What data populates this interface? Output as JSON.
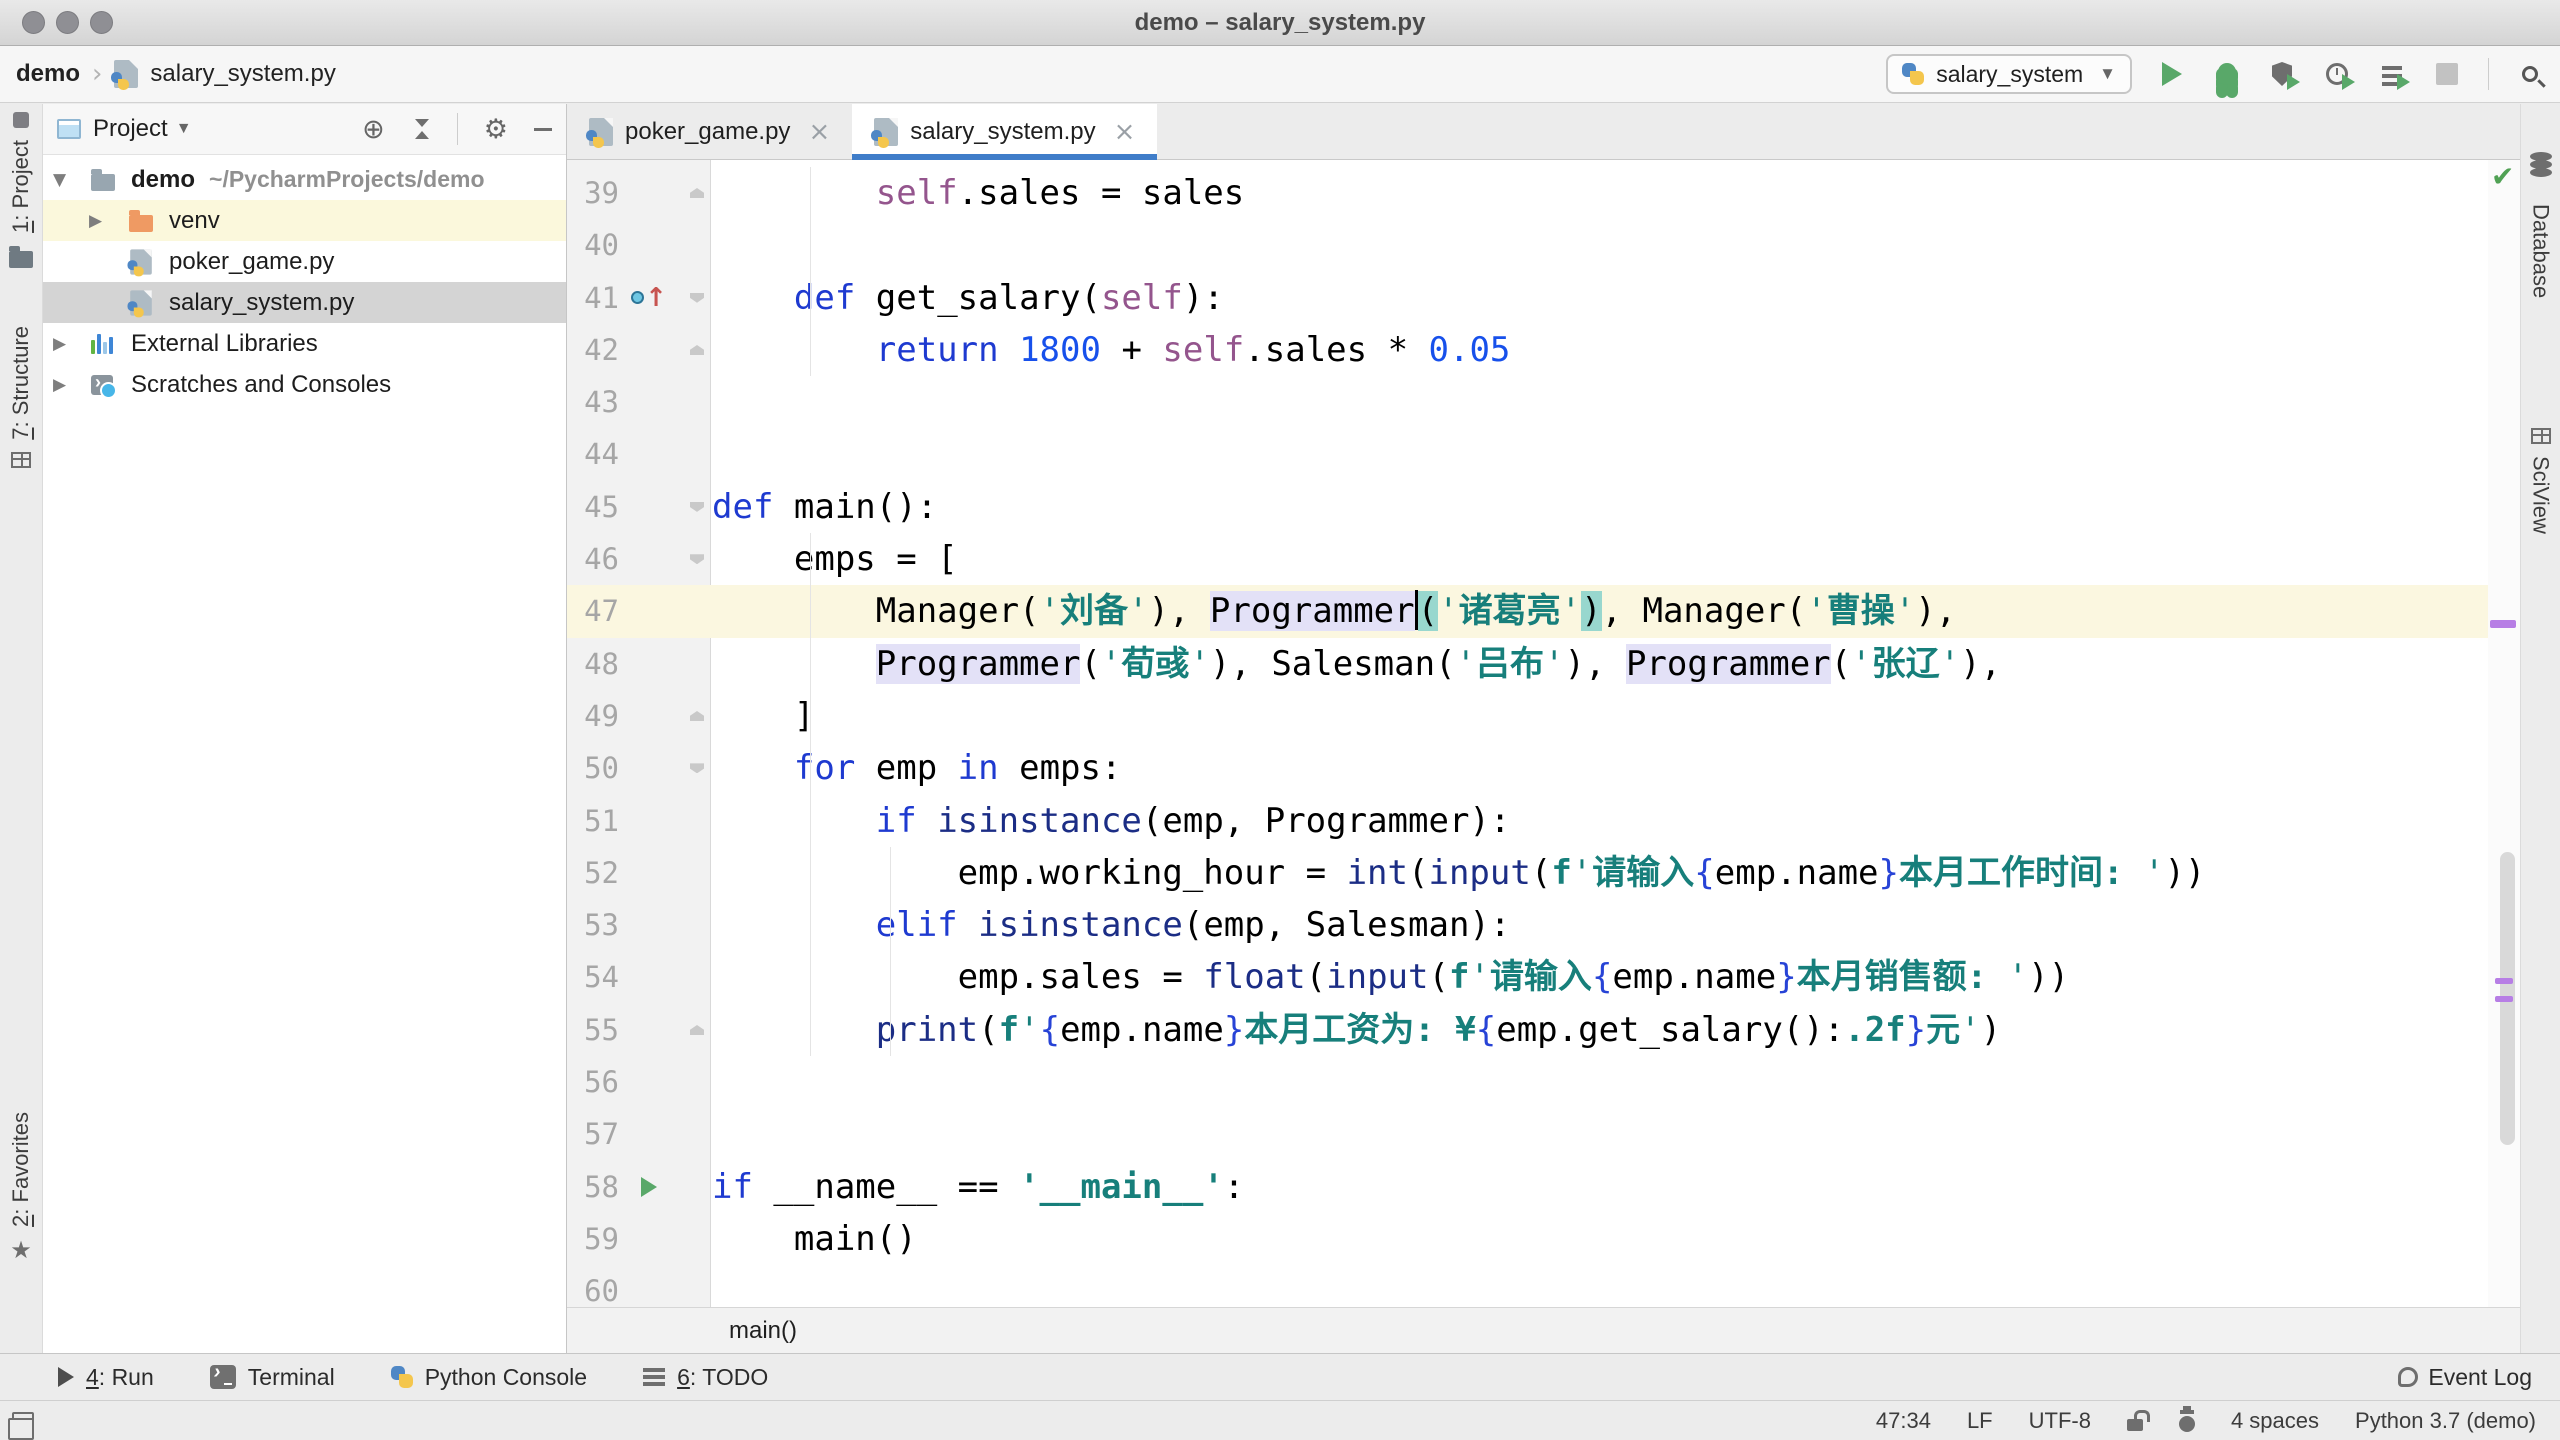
{
  "window": {
    "title": "demo – salary_system.py"
  },
  "topbar": {
    "project_crumb": "demo",
    "file_crumb": "salary_system.py",
    "run_config": "salary_system",
    "actions": [
      "run-icon",
      "debug-icon",
      "run-with-coverage-icon",
      "profiler-icon",
      "concurrency-diagram-icon",
      "stop-icon",
      "search-everywhere-icon"
    ]
  },
  "project_panel": {
    "header": "Project",
    "header_tools": [
      "locate-icon",
      "collapse-all-icon",
      "settings-gear-icon",
      "hide-panel-icon"
    ],
    "tree": [
      {
        "label": "demo",
        "path": "~/PycharmProjects/demo",
        "icon": "folder-gray",
        "chevron": "down",
        "bold": true,
        "level": 0
      },
      {
        "label": "venv",
        "icon": "folder-orange",
        "chevron": "right",
        "level": 1,
        "row": "warm"
      },
      {
        "label": "poker_game.py",
        "icon": "python-file",
        "level": 1
      },
      {
        "label": "salary_system.py",
        "icon": "python-file",
        "level": 1,
        "row": "sel"
      },
      {
        "label": "External Libraries",
        "icon": "libraries",
        "chevron": "right",
        "level": 0
      },
      {
        "label": "Scratches and Consoles",
        "icon": "scratches",
        "chevron": "right",
        "level": 0
      }
    ]
  },
  "tabs": [
    {
      "label": "poker_game.py",
      "active": false
    },
    {
      "label": "salary_system.py",
      "active": true
    }
  ],
  "editor": {
    "current_line": 47,
    "lines": [
      {
        "n": 39,
        "fold": "up",
        "tokens": [
          [
            "p",
            "        "
          ],
          [
            "sf",
            "self"
          ],
          [
            "p",
            ".sales = sales"
          ]
        ]
      },
      {
        "n": 40,
        "tokens": []
      },
      {
        "n": 41,
        "icon": "override",
        "fold": "down",
        "tokens": [
          [
            "p",
            "    "
          ],
          [
            "k",
            "def"
          ],
          [
            "p",
            " get_salary("
          ],
          [
            "sf",
            "self"
          ],
          [
            "p",
            "):"
          ]
        ]
      },
      {
        "n": 42,
        "fold": "up",
        "tokens": [
          [
            "p",
            "        "
          ],
          [
            "k",
            "return"
          ],
          [
            "p",
            " "
          ],
          [
            "n",
            "1800"
          ],
          [
            "p",
            " + "
          ],
          [
            "sf",
            "self"
          ],
          [
            "p",
            ".sales * "
          ],
          [
            "n",
            "0.05"
          ]
        ]
      },
      {
        "n": 43,
        "tokens": []
      },
      {
        "n": 44,
        "tokens": []
      },
      {
        "n": 45,
        "fold": "down",
        "tokens": [
          [
            "k",
            "def"
          ],
          [
            "p",
            " main():"
          ]
        ]
      },
      {
        "n": 46,
        "fold": "down",
        "tokens": [
          [
            "p",
            "    emps = ["
          ]
        ]
      },
      {
        "n": 47,
        "tokens": [
          [
            "p",
            "        Manager("
          ],
          [
            "s",
            "'"
          ],
          [
            "c",
            "刘备"
          ],
          [
            "s",
            "'"
          ],
          [
            "p",
            "), "
          ],
          [
            "hi",
            "Programmer"
          ],
          [
            "cr",
            ""
          ],
          [
            "mb",
            "("
          ],
          [
            "s",
            "'"
          ],
          [
            "c",
            "诸葛亮"
          ],
          [
            "s",
            "'"
          ],
          [
            "mb",
            ")"
          ],
          [
            "p",
            ", Manager("
          ],
          [
            "s",
            "'"
          ],
          [
            "c",
            "曹操"
          ],
          [
            "s",
            "'"
          ],
          [
            "p",
            "),"
          ]
        ]
      },
      {
        "n": 48,
        "tokens": [
          [
            "p",
            "        "
          ],
          [
            "hi",
            "Programmer"
          ],
          [
            "p",
            "("
          ],
          [
            "s",
            "'"
          ],
          [
            "c",
            "荀彧"
          ],
          [
            "s",
            "'"
          ],
          [
            "p",
            "), Salesman("
          ],
          [
            "s",
            "'"
          ],
          [
            "c",
            "吕布"
          ],
          [
            "s",
            "'"
          ],
          [
            "p",
            "), "
          ],
          [
            "hi",
            "Programmer"
          ],
          [
            "p",
            "("
          ],
          [
            "s",
            "'"
          ],
          [
            "c",
            "张辽"
          ],
          [
            "s",
            "'"
          ],
          [
            "p",
            "),"
          ]
        ]
      },
      {
        "n": 49,
        "fold": "up",
        "tokens": [
          [
            "p",
            "    ]"
          ]
        ]
      },
      {
        "n": 50,
        "fold": "down",
        "tokens": [
          [
            "p",
            "    "
          ],
          [
            "k",
            "for"
          ],
          [
            "p",
            " emp "
          ],
          [
            "k",
            "in"
          ],
          [
            "p",
            " emps:"
          ]
        ]
      },
      {
        "n": 51,
        "tokens": [
          [
            "p",
            "        "
          ],
          [
            "k",
            "if"
          ],
          [
            "p",
            " "
          ],
          [
            "b",
            "isinstance"
          ],
          [
            "p",
            "(emp, Programmer):"
          ]
        ]
      },
      {
        "n": 52,
        "tokens": [
          [
            "p",
            "            emp.working_hour = "
          ],
          [
            "b",
            "int"
          ],
          [
            "p",
            "("
          ],
          [
            "b",
            "input"
          ],
          [
            "p",
            "("
          ],
          [
            "sb",
            "f"
          ],
          [
            "s",
            "'"
          ],
          [
            "c",
            "请输入"
          ],
          [
            "br",
            "{"
          ],
          [
            "p",
            "emp.name"
          ],
          [
            "br",
            "}"
          ],
          [
            "c",
            "本月工作时间: "
          ],
          [
            "s",
            "'"
          ],
          [
            "p",
            "))"
          ]
        ]
      },
      {
        "n": 53,
        "tokens": [
          [
            "p",
            "        "
          ],
          [
            "k",
            "elif"
          ],
          [
            "p",
            " "
          ],
          [
            "b",
            "isinstance"
          ],
          [
            "p",
            "(emp, Salesman):"
          ]
        ]
      },
      {
        "n": 54,
        "tokens": [
          [
            "p",
            "            emp.sales = "
          ],
          [
            "b",
            "float"
          ],
          [
            "p",
            "("
          ],
          [
            "b",
            "input"
          ],
          [
            "p",
            "("
          ],
          [
            "sb",
            "f"
          ],
          [
            "s",
            "'"
          ],
          [
            "c",
            "请输入"
          ],
          [
            "br",
            "{"
          ],
          [
            "p",
            "emp.name"
          ],
          [
            "br",
            "}"
          ],
          [
            "c",
            "本月销售额: "
          ],
          [
            "s",
            "'"
          ],
          [
            "p",
            "))"
          ]
        ]
      },
      {
        "n": 55,
        "fold": "up",
        "tokens": [
          [
            "p",
            "        "
          ],
          [
            "b",
            "print"
          ],
          [
            "p",
            "("
          ],
          [
            "sb",
            "f"
          ],
          [
            "s",
            "'"
          ],
          [
            "br",
            "{"
          ],
          [
            "p",
            "emp.name"
          ],
          [
            "br",
            "}"
          ],
          [
            "c",
            "本月工资为: ¥"
          ],
          [
            "br",
            "{"
          ],
          [
            "p",
            "emp.get_salary()"
          ],
          [
            "p",
            ":"
          ],
          [
            "sb",
            ".2f"
          ],
          [
            "br",
            "}"
          ],
          [
            "c",
            "元"
          ],
          [
            "s",
            "'"
          ],
          [
            "p",
            ")"
          ]
        ]
      },
      {
        "n": 56,
        "tokens": []
      },
      {
        "n": 57,
        "tokens": []
      },
      {
        "n": 58,
        "icon": "run",
        "tokens": [
          [
            "k",
            "if"
          ],
          [
            "p",
            " __name__ == "
          ],
          [
            "sb",
            "'__main__'"
          ],
          [
            "p",
            ":"
          ]
        ]
      },
      {
        "n": 59,
        "tokens": [
          [
            "p",
            "    main()"
          ]
        ]
      },
      {
        "n": 60,
        "tokens": []
      }
    ]
  },
  "breadcrumb_bottom": "main()",
  "toolwindow_bar": {
    "left": [
      {
        "icon": "run-tool-icon",
        "label": "4: Run",
        "mn": "4"
      },
      {
        "icon": "terminal-icon",
        "label": "Terminal"
      },
      {
        "icon": "python-console-icon",
        "label": "Python Console"
      },
      {
        "icon": "todo-icon",
        "label": "6: TODO",
        "mn": "6"
      }
    ],
    "event_log": "Event Log"
  },
  "statusbar": {
    "items": [
      {
        "t": "47:34"
      },
      {
        "t": "LF"
      },
      {
        "t": "UTF-8"
      },
      {
        "i": "unlock-icon"
      },
      {
        "i": "hector-icon"
      },
      {
        "t": "4 spaces"
      },
      {
        "t": "Python 3.7 (demo)"
      }
    ]
  },
  "left_stripe": [
    {
      "label": "1: Project",
      "mn": "1",
      "icon": "folder-icon",
      "active": true
    },
    {
      "label": "7: Structure",
      "mn": "7",
      "icon": "structure-icon"
    },
    {
      "label": "2: Favorites",
      "mn": "2",
      "icon": "star-icon",
      "bottom": true
    }
  ],
  "right_stripe": [
    {
      "label": "Database",
      "icon": "database-icon"
    },
    {
      "label": "SciView",
      "icon": "sciview-icon"
    }
  ],
  "colors": {
    "tab_accent": "#3F7DC9",
    "run_green": "#59A869",
    "keyword": "#1E3AD0",
    "builtin": "#1B2D85",
    "number": "#1750EB",
    "string": "#177F7B",
    "self_param": "#94558D",
    "caret_row": "#FBF7E0",
    "identifier_highlight": "#E3E1F7",
    "brace_match": "#98D7CE",
    "stripe_mark": "#B77EE5"
  }
}
